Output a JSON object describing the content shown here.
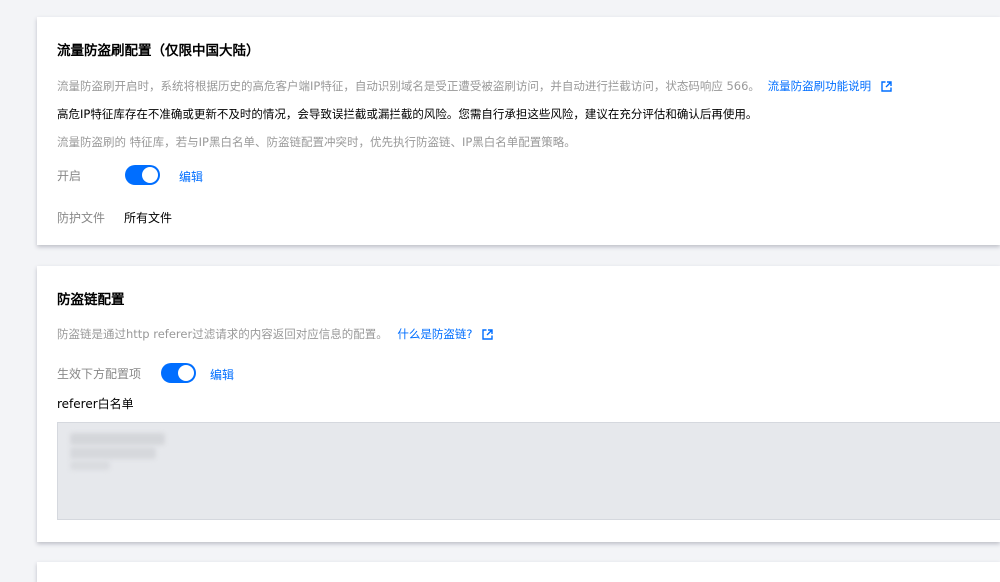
{
  "traffic": {
    "title": "流量防盗刷配置（仅限中国大陆）",
    "desc1": "流量防盗刷开启时，系统将根据历史的高危客户端IP特征，自动识别域名是受正遭受被盗刷访问，并自动进行拦截访问，状态码响应 566。",
    "desc1_link": "流量防盗刷功能说明",
    "warning": "高危IP特征库存在不准确或更新不及时的情况，会导致误拦截或漏拦截的风险。您需自行承担这些风险，建议在充分评估和确认后再使用。",
    "desc2": "流量防盗刷的 特征库，若与IP黑白名单、防盗链配置冲突时，优先执行防盗链、IP黑白名单配置策略。",
    "enable_label": "开启",
    "edit_label": "编辑",
    "file_label": "防护文件",
    "file_value": "所有文件"
  },
  "hotlink": {
    "title": "防盗链配置",
    "desc": "防盗链是通过http referer过滤请求的内容返回对应信息的配置。",
    "desc_link": "什么是防盗链?",
    "effective_label": "生效下方配置项",
    "edit_label": "编辑",
    "whitelist_label": "referer白名单"
  },
  "colors": {
    "accent": "#006eff",
    "toggle_on": "#006eff",
    "muted_text": "#999999",
    "background": "#f3f4f7"
  },
  "icons": {
    "external_link": "external-link-icon"
  },
  "toggles": {
    "traffic_enabled": true,
    "hotlink_enabled": true
  }
}
